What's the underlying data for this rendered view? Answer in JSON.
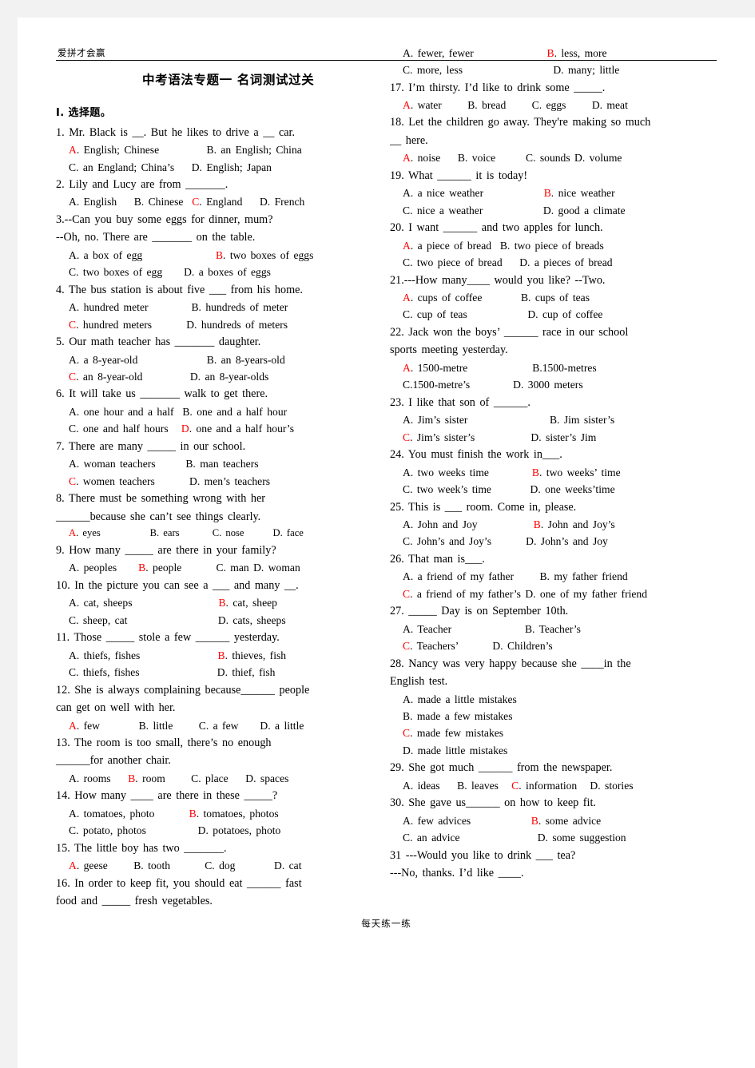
{
  "header": {
    "watermark": "爱拼才会赢",
    "title": "中考语法专题一  名词测试过关"
  },
  "footer": {
    "text": "每天练一练"
  },
  "colors": {
    "answer_red": "#ff0000",
    "text": "#000000",
    "page_bg": "#ffffff",
    "canvas_bg": "#f2f2f2"
  },
  "left_column": {
    "section_label": "I.  选择题。",
    "items": [
      {
        "stem": "1. Mr. Black is __. But he likes to drive a __ car.",
        "lines": [
          {
            "parts": [
              {
                "t": "A",
                "red": true
              },
              {
                "t": ". English; Chinese           B. an English; China"
              }
            ]
          },
          {
            "parts": [
              {
                "t": "C. an England; China’s    D. English; Japan"
              }
            ]
          }
        ]
      },
      {
        "stem": "2. Lily and Lucy are from _______.",
        "lines": [
          {
            "parts": [
              {
                "t": "A. English    B. Chinese  "
              },
              {
                "t": "C",
                "red": true
              },
              {
                "t": ". England    D. French"
              }
            ]
          }
        ]
      },
      {
        "stem": "3.--Can you buy some eggs for dinner, mum?",
        "stem2": "--Oh, no. There are _______ on the table.",
        "lines": [
          {
            "parts": [
              {
                "t": "A. a box of egg                 "
              },
              {
                "t": "B",
                "red": true
              },
              {
                "t": ". two boxes of eggs"
              }
            ]
          },
          {
            "parts": [
              {
                "t": "C. two boxes of egg     D. a boxes of eggs"
              }
            ]
          }
        ]
      },
      {
        "stem": "4. The bus station is about five ___ from his home.",
        "lines": [
          {
            "parts": [
              {
                "t": "A. hundred meter          B. hundreds of meter"
              }
            ]
          },
          {
            "parts": [
              {
                "t": "C",
                "red": true
              },
              {
                "t": ". hundred meters        D. hundreds of meters"
              }
            ]
          }
        ]
      },
      {
        "stem": "5. Our math teacher has _______ daughter.",
        "lines": [
          {
            "parts": [
              {
                "t": "A. a 8-year-old                B. an 8-years-old"
              }
            ]
          },
          {
            "parts": [
              {
                "t": "C",
                "red": true
              },
              {
                "t": ". an 8-year-old           D. an 8-year-olds"
              }
            ]
          }
        ]
      },
      {
        "stem": "6. It will take us _______ walk to get there.",
        "lines": [
          {
            "parts": [
              {
                "t": "A. one hour and a half  B. one and a half hour"
              }
            ]
          },
          {
            "parts": [
              {
                "t": "C. one and half hours   "
              },
              {
                "t": "D",
                "red": true
              },
              {
                "t": ". one and a half hour’s"
              }
            ]
          }
        ]
      },
      {
        "stem": "7. There are many _____ in our school.",
        "lines": [
          {
            "parts": [
              {
                "t": "A. woman teachers       B. man teachers"
              }
            ]
          },
          {
            "parts": [
              {
                "t": "C",
                "red": true
              },
              {
                "t": ". women teachers        D. men’s teachers"
              }
            ]
          }
        ]
      },
      {
        "stem": "8.   There   must   be   something   wrong   with   her",
        "stem2": "______because she can’t see things clearly.",
        "small": true,
        "lines": [
          {
            "parts": [
              {
                "t": "A",
                "red": true
              },
              {
                "t": ". eyes            B. ears        C. nose       D. face"
              }
            ]
          }
        ]
      },
      {
        "stem": "9. How many _____ are there in your family?",
        "lines": [
          {
            "parts": [
              {
                "t": "A. peoples     "
              },
              {
                "t": "B",
                "red": true
              },
              {
                "t": ". people        C. man D. woman"
              }
            ]
          }
        ]
      },
      {
        "stem": "10. In the picture you can see a ___ and many __.",
        "lines": [
          {
            "parts": [
              {
                "t": "A. cat, sheeps                    "
              },
              {
                "t": "B",
                "red": true
              },
              {
                "t": ". cat, sheep"
              }
            ]
          },
          {
            "parts": [
              {
                "t": "C. sheep, cat                     D. cats, sheeps"
              }
            ]
          }
        ]
      },
      {
        "stem": "11. Those _____ stole a few ______ yesterday.",
        "lines": [
          {
            "parts": [
              {
                "t": "A. thiefs, fishes                  "
              },
              {
                "t": "B",
                "red": true
              },
              {
                "t": ". thieves, fish"
              }
            ]
          },
          {
            "parts": [
              {
                "t": "C. thiefs, fishes                  D. thief, fish"
              }
            ]
          }
        ]
      },
      {
        "stem": "12. She is always complaining because______ people",
        "stem2": "can get on well with her.",
        "lines": [
          {
            "parts": [
              {
                "t": "A",
                "red": true
              },
              {
                "t": ". few         B. little      C. a few     D. a little"
              }
            ]
          }
        ]
      },
      {
        "stem": "13.   The   room   is   too   small,   there’s   no   enough",
        "stem2": "______for another chair.",
        "lines": [
          {
            "parts": [
              {
                "t": "A. rooms    "
              },
              {
                "t": "B",
                "red": true
              },
              {
                "t": ". room      C. place    D. spaces"
              }
            ]
          }
        ]
      },
      {
        "stem": "14. How many ____ are there in these _____?",
        "lines": [
          {
            "parts": [
              {
                "t": "A. tomatoes, photo        "
              },
              {
                "t": "B",
                "red": true
              },
              {
                "t": ". tomatoes, photos"
              }
            ]
          },
          {
            "parts": [
              {
                "t": "C. potato, photos            D. potatoes, photo"
              }
            ]
          }
        ]
      },
      {
        "stem": "15. The little boy has two _______.",
        "lines": [
          {
            "parts": [
              {
                "t": "A",
                "red": true
              },
              {
                "t": ". geese      B. tooth        C. dog         D. cat"
              }
            ]
          }
        ]
      },
      {
        "stem": "16. In order to keep fit, you should eat ______ fast",
        "stem2": "food and _____ fresh vegetables.",
        "lines": []
      }
    ]
  },
  "right_column": {
    "items": [
      {
        "stem": "",
        "lines": [
          {
            "parts": [
              {
                "t": "A. fewer, fewer                 "
              },
              {
                "t": "B",
                "red": true
              },
              {
                "t": ". less, more"
              }
            ]
          },
          {
            "parts": [
              {
                "t": "C. more, less                     D. many; little"
              }
            ]
          }
        ]
      },
      {
        "stem": "17. I’m thirsty. I’d like to drink some _____.",
        "lines": [
          {
            "parts": [
              {
                "t": "A",
                "red": true
              },
              {
                "t": ". water      B. bread      C. eggs      D. meat"
              }
            ]
          }
        ]
      },
      {
        "stem": "18. Let the children go away. They're making so much",
        "stem2": "__ here.",
        "lines": [
          {
            "parts": [
              {
                "t": "A",
                "red": true
              },
              {
                "t": ". noise    B. voice       C. sounds D. volume"
              }
            ]
          }
        ]
      },
      {
        "stem": "19. What ______ it is today!",
        "lines": [
          {
            "parts": [
              {
                "t": "A. a nice weather              "
              },
              {
                "t": "B",
                "red": true
              },
              {
                "t": ". nice weather"
              }
            ]
          },
          {
            "parts": [
              {
                "t": "C. nice a weather              D. good a climate"
              }
            ]
          }
        ]
      },
      {
        "stem": "20. I want ______ and two apples for lunch.",
        "lines": [
          {
            "parts": [
              {
                "t": "A",
                "red": true
              },
              {
                "t": ". a piece of bread  B. two piece of breads"
              }
            ]
          },
          {
            "parts": [
              {
                "t": "C. two piece of bread    D. a pieces of bread"
              }
            ]
          }
        ]
      },
      {
        "stem": "21.---How many____ would you like?    --Two.",
        "lines": [
          {
            "parts": [
              {
                "t": "A",
                "red": true
              },
              {
                "t": ". cups of coffee         B. cups of teas"
              }
            ]
          },
          {
            "parts": [
              {
                "t": "C. cup of teas              D. cup of coffee"
              }
            ]
          }
        ]
      },
      {
        "stem": "22.  Jack  won  the  boys’  ______  race  in  our  school",
        "stem2": "sports meeting yesterday.",
        "stem2_indent": true,
        "lines": [
          {
            "parts": [
              {
                "t": "A",
                "red": true
              },
              {
                "t": ". 1500-metre               B.1500-metres"
              }
            ]
          },
          {
            "parts": [
              {
                "t": "C.1500-metre’s          D. 3000 meters"
              }
            ]
          }
        ]
      },
      {
        "stem": "23. I like that son of ______.",
        "lines": [
          {
            "parts": [
              {
                "t": "A. Jim’s sister                   B. Jim sister’s"
              }
            ]
          },
          {
            "parts": [
              {
                "t": "C",
                "red": true
              },
              {
                "t": ". Jim’s sister’s             D. sister’s Jim"
              }
            ]
          }
        ]
      },
      {
        "stem": "24. You must finish the work in___.",
        "lines": [
          {
            "parts": [
              {
                "t": "A. two weeks time          "
              },
              {
                "t": "B",
                "red": true
              },
              {
                "t": ". two weeks’ time"
              }
            ]
          },
          {
            "parts": [
              {
                "t": "C. two week’s time         D. one weeks’time"
              }
            ]
          }
        ]
      },
      {
        "stem": "25. This is ___ room. Come in, please.",
        "lines": [
          {
            "parts": [
              {
                "t": "A. John and Joy             "
              },
              {
                "t": "B",
                "red": true
              },
              {
                "t": ". John and Joy’s"
              }
            ]
          },
          {
            "parts": [
              {
                "t": "C. John’s and Joy’s        D. John’s and Joy"
              }
            ]
          }
        ]
      },
      {
        "stem": "26. That man is___.",
        "lines": [
          {
            "parts": [
              {
                "t": "A. a friend of my father      B. my father friend"
              }
            ]
          },
          {
            "parts": [
              {
                "t": "C",
                "red": true
              },
              {
                "t": ". a friend of my father’s D. one of my father friend"
              }
            ]
          }
        ]
      },
      {
        "stem": "27. _____ Day is on September 10th.",
        "lines": [
          {
            "parts": [
              {
                "t": "A. Teacher                 B. Teacher’s"
              }
            ]
          },
          {
            "parts": [
              {
                "t": "C",
                "red": true
              },
              {
                "t": ". Teachers’        D. Children’s"
              }
            ]
          }
        ]
      },
      {
        "stem": "28.  Nancy  was  very  happy  because  she  ____in  the",
        "stem2": "English test.",
        "stem2_indent": true,
        "lines": [
          {
            "parts": [
              {
                "t": "A. made a little mistakes"
              }
            ]
          },
          {
            "parts": [
              {
                "t": "B. made a few mistakes"
              }
            ]
          },
          {
            "parts": [
              {
                "t": "C",
                "red": true
              },
              {
                "t": ". made few mistakes"
              }
            ]
          },
          {
            "parts": [
              {
                "t": "D. made little mistakes"
              }
            ]
          }
        ]
      },
      {
        "stem": "29. She got much ______ from the newspaper.",
        "lines": [
          {
            "parts": [
              {
                "t": "A. ideas    B. leaves   "
              },
              {
                "t": "C",
                "red": true
              },
              {
                "t": ". information   D. stories"
              }
            ]
          }
        ]
      },
      {
        "stem": "30. She gave us______ on how to keep fit.",
        "lines": [
          {
            "parts": [
              {
                "t": "A. few advices              "
              },
              {
                "t": "B",
                "red": true
              },
              {
                "t": ". some advice"
              }
            ]
          },
          {
            "parts": [
              {
                "t": "C. an advice                  D. some suggestion"
              }
            ]
          }
        ]
      },
      {
        "stem": "31 ---Would you like to drink ___ tea?",
        "stem2": "---No, thanks. I’d like ____.",
        "lines": []
      }
    ]
  }
}
